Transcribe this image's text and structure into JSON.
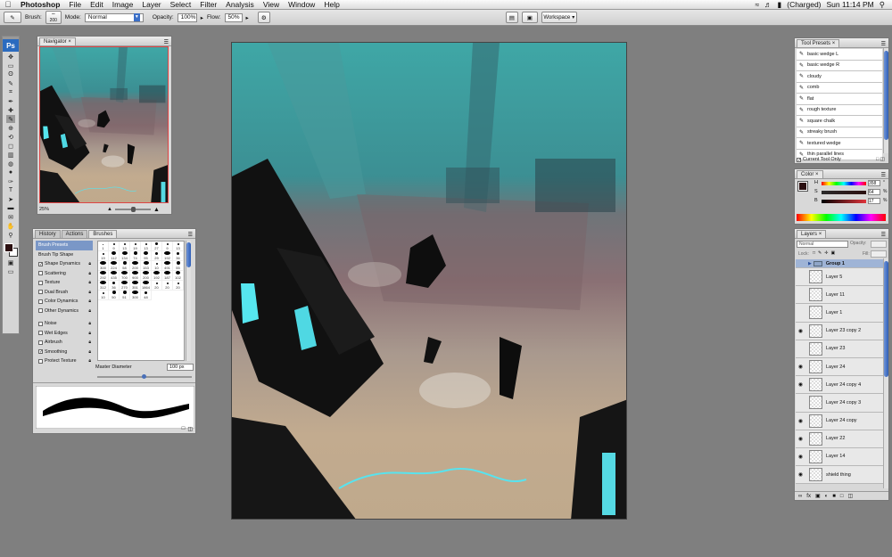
{
  "menubar": {
    "app_name": "Photoshop",
    "items": [
      "File",
      "Edit",
      "Image",
      "Layer",
      "Select",
      "Filter",
      "Analysis",
      "View",
      "Window",
      "Help"
    ],
    "battery": "(Charged)",
    "clock": "Sun 11:14 PM"
  },
  "options_bar": {
    "brush_label": "Brush:",
    "brush_size": "200",
    "mode_label": "Mode:",
    "mode_value": "Normal",
    "opacity_label": "Opacity:",
    "opacity_value": "100%",
    "flow_label": "Flow:",
    "flow_value": "50%",
    "workspace_label": "Workspace"
  },
  "toolbox": {
    "logo": "Ps"
  },
  "navigator": {
    "tab": "Navigator",
    "zoom": "25%"
  },
  "brushes_panel": {
    "tabs": [
      "History",
      "Actions",
      "Brushes"
    ],
    "items": [
      {
        "label": "Brush Presets",
        "checked": false,
        "highlight": true,
        "checkbox": false
      },
      {
        "label": "Brush Tip Shape",
        "checked": false,
        "highlight": false,
        "checkbox": false
      },
      {
        "label": "Shape Dynamics",
        "checked": true,
        "highlight": false,
        "checkbox": true
      },
      {
        "label": "Scattering",
        "checked": false,
        "highlight": false,
        "checkbox": true
      },
      {
        "label": "Texture",
        "checked": false,
        "highlight": false,
        "checkbox": true
      },
      {
        "label": "Dual Brush",
        "checked": false,
        "highlight": false,
        "checkbox": true
      },
      {
        "label": "Color Dynamics",
        "checked": false,
        "highlight": false,
        "checkbox": true
      },
      {
        "label": "Other Dynamics",
        "checked": false,
        "highlight": false,
        "checkbox": true
      },
      {
        "label": "Noise",
        "checked": false,
        "highlight": false,
        "checkbox": true
      },
      {
        "label": "Wet Edges",
        "checked": false,
        "highlight": false,
        "checkbox": true
      },
      {
        "label": "Airbrush",
        "checked": false,
        "highlight": false,
        "checkbox": true
      },
      {
        "label": "Smoothing",
        "checked": true,
        "highlight": false,
        "checkbox": true
      },
      {
        "label": "Protect Texture",
        "checked": false,
        "highlight": false,
        "checkbox": true
      }
    ],
    "brush_sizes": [
      "1",
      "9",
      "13",
      "19",
      "13",
      "27",
      "9",
      "13",
      "19",
      "112",
      "134",
      "74",
      "95",
      "29",
      "192",
      "36",
      "300",
      "224",
      "58",
      "200",
      "153",
      "10",
      "491",
      "55",
      "292",
      "435",
      "700",
      "900",
      "200",
      "192",
      "187",
      "102",
      "312",
      "36",
      "270",
      "351",
      "1864",
      "20",
      "20",
      "20",
      "10",
      "50",
      "51",
      "300",
      "48"
    ],
    "master_diameter_label": "Master Diameter",
    "master_diameter_value": "100 px"
  },
  "tool_presets": {
    "tab": "Tool Presets",
    "items": [
      "basic wedge L",
      "basic wedge R",
      "cloudy",
      "comb",
      "flat",
      "rough texture",
      "square chalk",
      "streaky brush",
      "textured wedge",
      "thin parallel lines"
    ],
    "current_tool_only": "Current Tool Only"
  },
  "color_panel": {
    "tab": "Color",
    "h_label": "H",
    "h_value": "358",
    "s_label": "S",
    "s_value": "64",
    "b_label": "B",
    "b_value": "17",
    "unit_deg": "°",
    "unit_pct": "%"
  },
  "layers_panel": {
    "tab": "Layers",
    "blend_mode": "Normal",
    "opacity_label": "Opacity:",
    "lock_label": "Lock:",
    "fill_label": "Fill:",
    "layers": [
      {
        "name": "Group 1",
        "visible": false,
        "group": true,
        "selected": true
      },
      {
        "name": "Layer 5",
        "visible": false,
        "group": false,
        "selected": false
      },
      {
        "name": "Layer 11",
        "visible": false,
        "group": false,
        "selected": false
      },
      {
        "name": "Layer 1",
        "visible": false,
        "group": false,
        "selected": false
      },
      {
        "name": "Layer 23 copy 2",
        "visible": true,
        "group": false,
        "selected": false
      },
      {
        "name": "Layer 23",
        "visible": false,
        "group": false,
        "selected": false
      },
      {
        "name": "Layer 24",
        "visible": true,
        "group": false,
        "selected": false
      },
      {
        "name": "Layer 24 copy 4",
        "visible": true,
        "group": false,
        "selected": false
      },
      {
        "name": "Layer 24 copy 3",
        "visible": false,
        "group": false,
        "selected": false
      },
      {
        "name": "Layer 24 copy",
        "visible": true,
        "group": false,
        "selected": false
      },
      {
        "name": "Layer 22",
        "visible": true,
        "group": false,
        "selected": false
      },
      {
        "name": "Layer 14",
        "visible": true,
        "group": false,
        "selected": false
      },
      {
        "name": "shield thing",
        "visible": true,
        "group": false,
        "selected": false
      }
    ]
  },
  "colors": {
    "accent": "#3b6fc7",
    "foreground_swatch": "#2b0f10"
  }
}
